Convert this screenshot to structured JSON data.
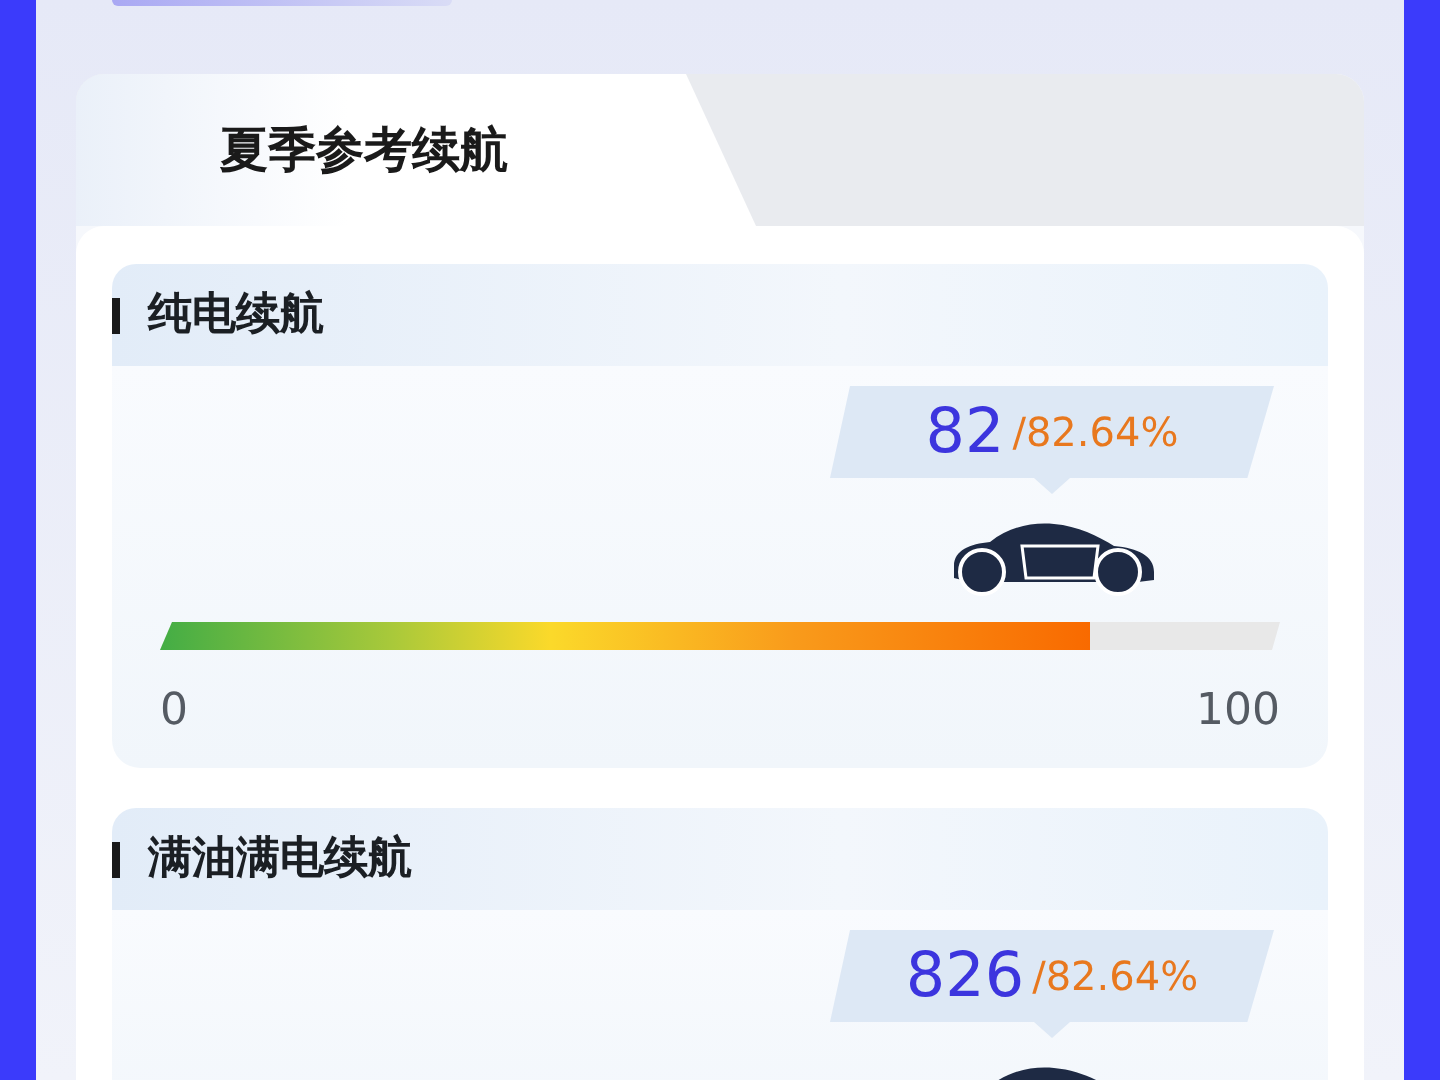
{
  "tab": {
    "label": "夏季参考续航",
    "selected": true
  },
  "sections": [
    {
      "title": "纯电续航",
      "value": "82",
      "percent": "/82.64%",
      "level": 0.83,
      "min_label": "0",
      "max_label": "100"
    },
    {
      "title": "满油满电续航",
      "value": "826",
      "percent": "/82.64%"
    }
  ]
}
